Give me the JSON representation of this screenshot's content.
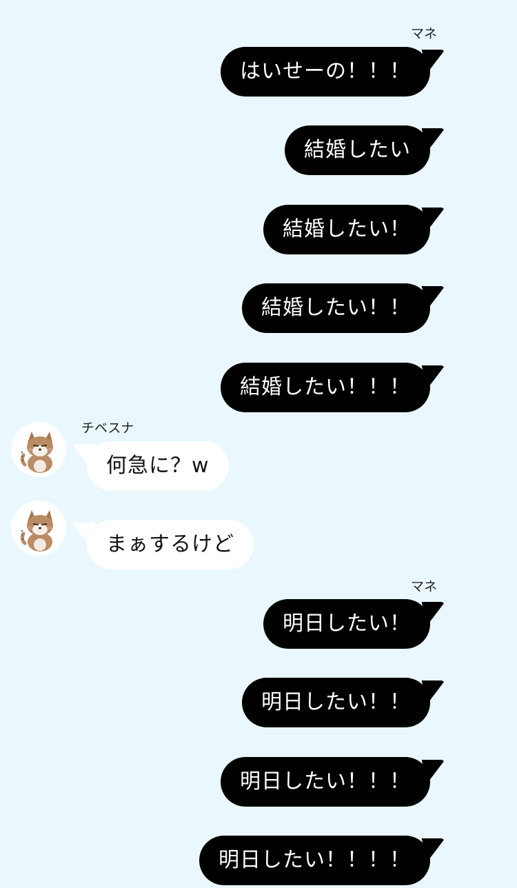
{
  "chat": {
    "messages": [
      {
        "side": "right",
        "sender": "マネ",
        "text": "はいせーの！！！"
      },
      {
        "side": "right",
        "text": "結婚したい"
      },
      {
        "side": "right",
        "text": "結婚したい！"
      },
      {
        "side": "right",
        "text": "結婚したい！！"
      },
      {
        "side": "right",
        "text": "結婚したい！！！"
      },
      {
        "side": "left",
        "sender": "チベスナ",
        "avatar": "fox-avatar-icon",
        "text": "何急に？w"
      },
      {
        "side": "left",
        "avatar": "fox-avatar-icon",
        "text": "まぁするけど"
      },
      {
        "side": "right",
        "sender": "マネ",
        "text": "明日したい！"
      },
      {
        "side": "right",
        "text": "明日したい！！"
      },
      {
        "side": "right",
        "text": "明日したい！！！"
      },
      {
        "side": "right",
        "text": "明日したい！！！！"
      }
    ]
  },
  "colors": {
    "background": "#eaf8fe",
    "right_bubble": "#000000",
    "right_text": "#ffffff",
    "left_bubble": "#ffffff",
    "left_text": "#111111"
  }
}
